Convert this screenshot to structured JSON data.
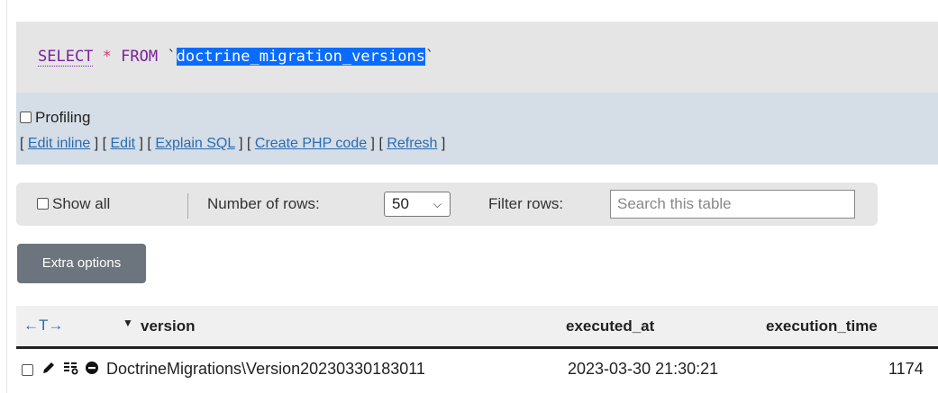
{
  "sql": {
    "select": "SELECT",
    "star": "*",
    "from": "FROM",
    "backtick_open": "`",
    "table": "doctrine_migration_versions",
    "backtick_close": "`"
  },
  "profiling": {
    "label": "Profiling",
    "links": [
      "Edit inline",
      "Edit",
      "Explain SQL",
      "Create PHP code",
      "Refresh"
    ]
  },
  "toolbar": {
    "show_all_label": "Show all",
    "rows_label": "Number of rows:",
    "rows_value": "50",
    "filter_label": "Filter rows:",
    "filter_placeholder": "Search this table"
  },
  "extra_options_label": "Extra options",
  "table": {
    "arrows": "←T→",
    "sort_indicator": "▼",
    "columns": [
      "version",
      "executed_at",
      "execution_time"
    ],
    "rows": [
      {
        "version": "DoctrineMigrations\\Version20230330183011",
        "executed_at": "2023-03-30 21:30:21",
        "execution_time": "1174"
      }
    ]
  },
  "icons": {
    "edit": "pencil-icon",
    "copy": "copy-icon",
    "delete": "delete-icon"
  }
}
